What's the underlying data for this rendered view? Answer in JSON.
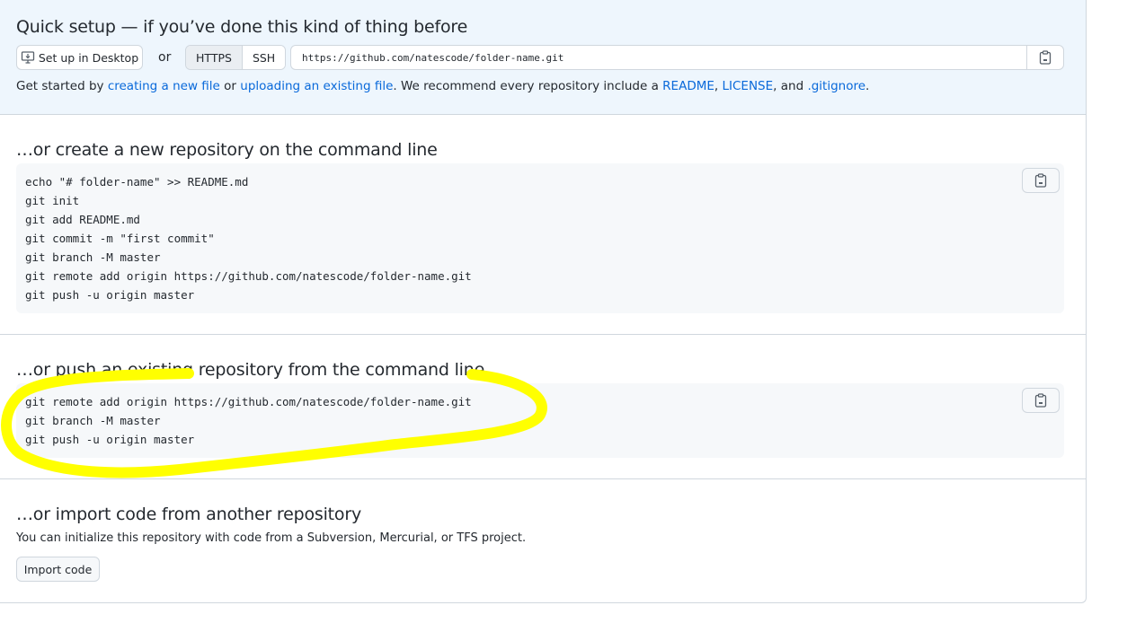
{
  "quick_setup": {
    "title": "Quick setup — if you’ve done this kind of thing before",
    "desktop_button": "Set up in Desktop",
    "or_label": "or",
    "protocols": [
      "HTTPS",
      "SSH"
    ],
    "selected_protocol": "HTTPS",
    "clone_url": "https://github.com/natescode/folder-name.git",
    "help": {
      "prefix": "Get started by ",
      "link_new_file": "creating a new file",
      "middle": " or ",
      "link_upload": "uploading an existing file",
      "recommend": ". We recommend every repository include a ",
      "link_readme": "README",
      "sep1": ", ",
      "link_license": "LICENSE",
      "sep2": ", and ",
      "link_gitignore": ".gitignore",
      "suffix": "."
    }
  },
  "new_repo": {
    "title": "…or create a new repository on the command line",
    "lines": [
      "echo \"# folder-name\" >> README.md",
      "git init",
      "git add README.md",
      "git commit -m \"first commit\"",
      "git branch -M master",
      "git remote add origin https://github.com/natescode/folder-name.git",
      "git push -u origin master"
    ]
  },
  "push_existing": {
    "title": "…or push an existing repository from the command line",
    "lines": [
      "git remote add origin https://github.com/natescode/folder-name.git",
      "git branch -M master",
      "git push -u origin master"
    ]
  },
  "import": {
    "title": "…or import code from another repository",
    "description": "You can initialize this repository with code from a Subversion, Mercurial, or TFS project.",
    "button": "Import code"
  },
  "icons": {
    "copy": "clipboard-icon",
    "desktop": "desktop-icon"
  },
  "colors": {
    "link": "#0969da",
    "quick_setup_bg": "#eef6fd",
    "code_bg": "#f6f8fa",
    "highlight": "#ffff00"
  }
}
